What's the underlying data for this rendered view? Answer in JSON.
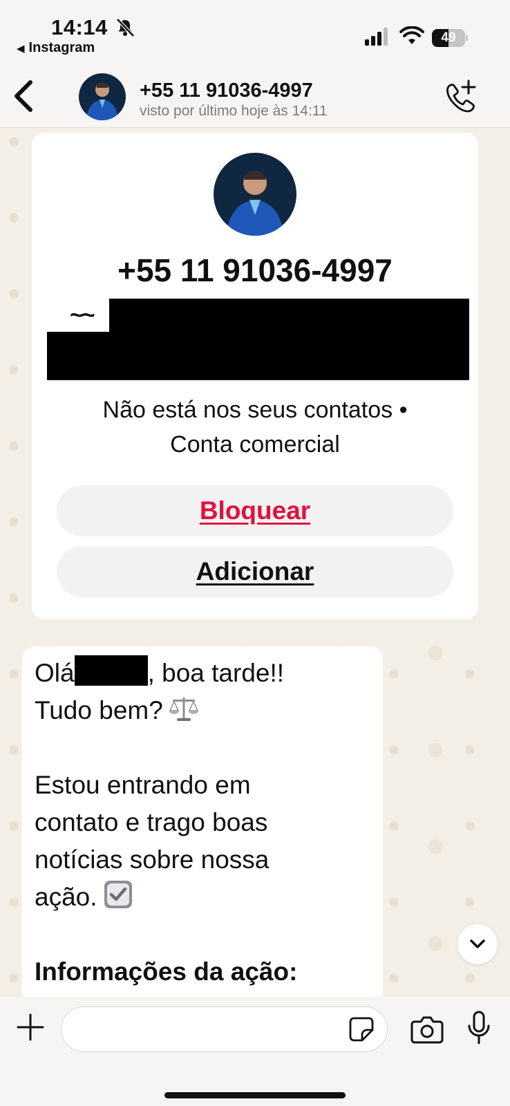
{
  "status_bar": {
    "time": "14:14",
    "back_app": "Instagram",
    "battery_percent": "49",
    "battery_level": 0.49,
    "icons": [
      "bell-slash-icon",
      "signal-icon",
      "wifi-icon",
      "battery-icon"
    ]
  },
  "header": {
    "contact_name": "+55 11 91036-4997",
    "last_seen": "visto por último hoje às 14:11",
    "icons": [
      "chevron-left-icon",
      "avatar",
      "call-add-icon"
    ]
  },
  "info_card": {
    "number": "+55 11 91036-4997",
    "tilde": "~~",
    "note_line1": "Não está nos seus contatos •",
    "note_line2": "Conta comercial",
    "block_label": "Bloquear",
    "add_label": "Adicionar",
    "colors": {
      "block": "#e0113f"
    }
  },
  "message": {
    "greeting_prefix": "Olá",
    "greeting_suffix": ", boa tarde!!",
    "line2": "Tudo bem?",
    "line3": "Estou entrando em",
    "line4": "contato e trago boas",
    "line5": "notícias sobre nossa",
    "line6": "ação.",
    "heading": "Informações da ação:",
    "emojis": [
      "balance-scale-icon",
      "check-box-icon"
    ]
  },
  "input_bar": {
    "placeholder": "",
    "icons": [
      "plus-icon",
      "sticker-icon",
      "camera-icon",
      "microphone-icon"
    ]
  },
  "colors": {
    "chat_background": "#f3efe6",
    "header_background": "#f6f5f3"
  }
}
